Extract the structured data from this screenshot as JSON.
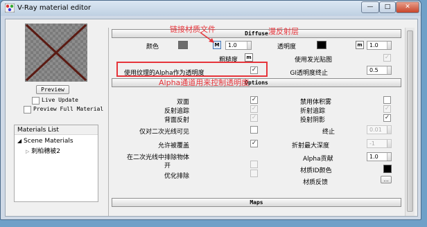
{
  "window": {
    "title": "V-Ray material editor",
    "colors": {
      "titlebar": "#c8d8ea",
      "client": "#f0f0f0",
      "annotation": "#e6343a"
    }
  },
  "controls": {
    "minimize": "—",
    "maximize": "□",
    "close": "✕"
  },
  "left": {
    "preview_label": "Preview",
    "live_update": {
      "label": "Live Update",
      "checked": false
    },
    "preview_full": {
      "label": "Preview Full Material",
      "checked": false
    },
    "tree": {
      "header": "Materials List",
      "root": "Scene Materials",
      "child": "刺柏穗被2"
    }
  },
  "rollouts": {
    "diffuse": "Diffuse",
    "options": "Options",
    "maps": "Maps"
  },
  "diffuse": {
    "color_label": "颜色",
    "color_value": "1.0",
    "map_button": "M",
    "transparency_label": "透明度",
    "transparency_value": "1.0",
    "transparency_map_button": "m",
    "roughness_label": "粗糙度",
    "roughness_map_button": "m",
    "use_emissive_label": "使用发光贴图",
    "use_emissive_checked": true,
    "alpha_transparency_label": "使用纹理的Alpha作为透明度",
    "alpha_transparency_checked": true,
    "gi_cutoff_label": "GI透明度终止",
    "gi_cutoff_value": "0.5",
    "swatch_color": "#6d6d6d",
    "transparency_color": "#000000"
  },
  "options": {
    "left_items": [
      {
        "label": "双面",
        "state": "checked"
      },
      {
        "label": "反射追踪",
        "state": "checked-disabled"
      },
      {
        "label": "背面反射",
        "state": "checked-disabled"
      },
      {
        "label": "仅对二次光线可见",
        "state": "unchecked"
      },
      {
        "label": "允许被覆盖",
        "state": "checked"
      },
      {
        "label": "在二次光线中排除物体",
        "state": "none"
      },
      {
        "label": "开",
        "state": "unchecked-disabled"
      },
      {
        "label": "优化排除",
        "state": "unchecked-disabled"
      }
    ],
    "right_items": [
      {
        "label": "禁用体积雾",
        "state": "unchecked"
      },
      {
        "label": "折射追踪",
        "state": "checked-disabled"
      },
      {
        "label": "投射阴影",
        "state": "checked"
      },
      {
        "label": "终止",
        "value": "0.01",
        "disabled": true
      },
      {
        "label": "折射最大深度",
        "value": "-1",
        "disabled": true
      },
      {
        "label": "Alpha贡献",
        "value": "1.0",
        "disabled": false
      },
      {
        "label": "材质ID颜色",
        "color": "#000000"
      },
      {
        "label": "材质反馈",
        "button": "..."
      }
    ]
  },
  "annotations": {
    "link_map": "链接材质文件",
    "diffuse_note": "漫反射层",
    "alpha_note": "Alpha通道用来控制透明度"
  }
}
